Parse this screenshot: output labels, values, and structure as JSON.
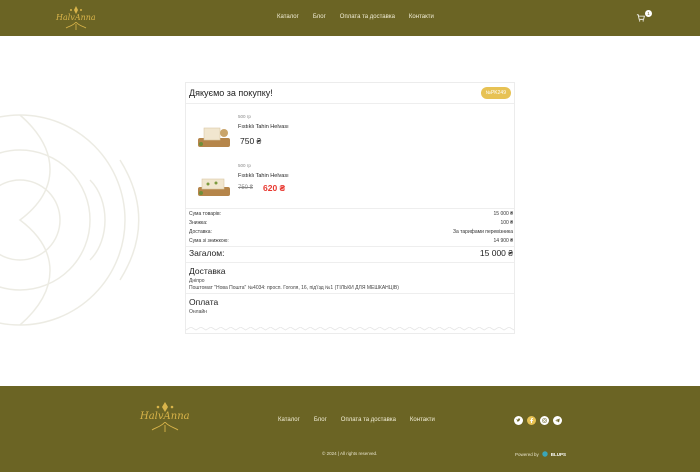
{
  "brand": {
    "name": "HalvAnna"
  },
  "nav": [
    "Каталог",
    "Блог",
    "Оплата та доставка",
    "Контакти"
  ],
  "cart": {
    "count": "1"
  },
  "order": {
    "title": "Дякуємо за покупку!",
    "number": "№PK249",
    "items": [
      {
        "weight": "500 гр",
        "name": "Fıstıklı Tahin Helvası",
        "price": "750 ₴",
        "old_price": "",
        "new_price": ""
      },
      {
        "weight": "500 гр",
        "name": "Fıstıklı Tahin Helvası",
        "price": "",
        "old_price": "750 ₴",
        "new_price": "620 ₴"
      }
    ],
    "summary": [
      {
        "label": "Сума товарів:",
        "value": "15 000 ₴"
      },
      {
        "label": "Знижка:",
        "value": "100 ₴"
      },
      {
        "label": "Доставка:",
        "value": "За тарифами перевізника"
      },
      {
        "label": "Сума зі знижкою:",
        "value": "14 900 ₴"
      }
    ],
    "total": {
      "label": "Загалом:",
      "value": "15 000 ₴"
    },
    "delivery": {
      "title": "Доставка",
      "city": "Дніпро",
      "address": "Поштомат \"Нова Пошта\" №4034: просп. Гоголя, 16, під'їзд №1 (ТІЛЬКИ ДЛЯ МЕШКАНЦІВ)"
    },
    "payment": {
      "title": "Оплата",
      "method": "Онлайн"
    }
  },
  "footer": {
    "nav": [
      "Каталог",
      "Блог",
      "Оплата та доставка",
      "Контакти"
    ],
    "socials": [
      "twitter-icon",
      "facebook-icon",
      "instagram-icon",
      "telegram-icon"
    ],
    "copyright": "© 2024 | All rights reserved.",
    "powered_by": "Powered by",
    "powered_brand": "BLUPS"
  },
  "colors": {
    "olive": "#6b6424",
    "gold": "#d9b44a",
    "badge": "#e7c254",
    "sale": "#e8372f"
  }
}
